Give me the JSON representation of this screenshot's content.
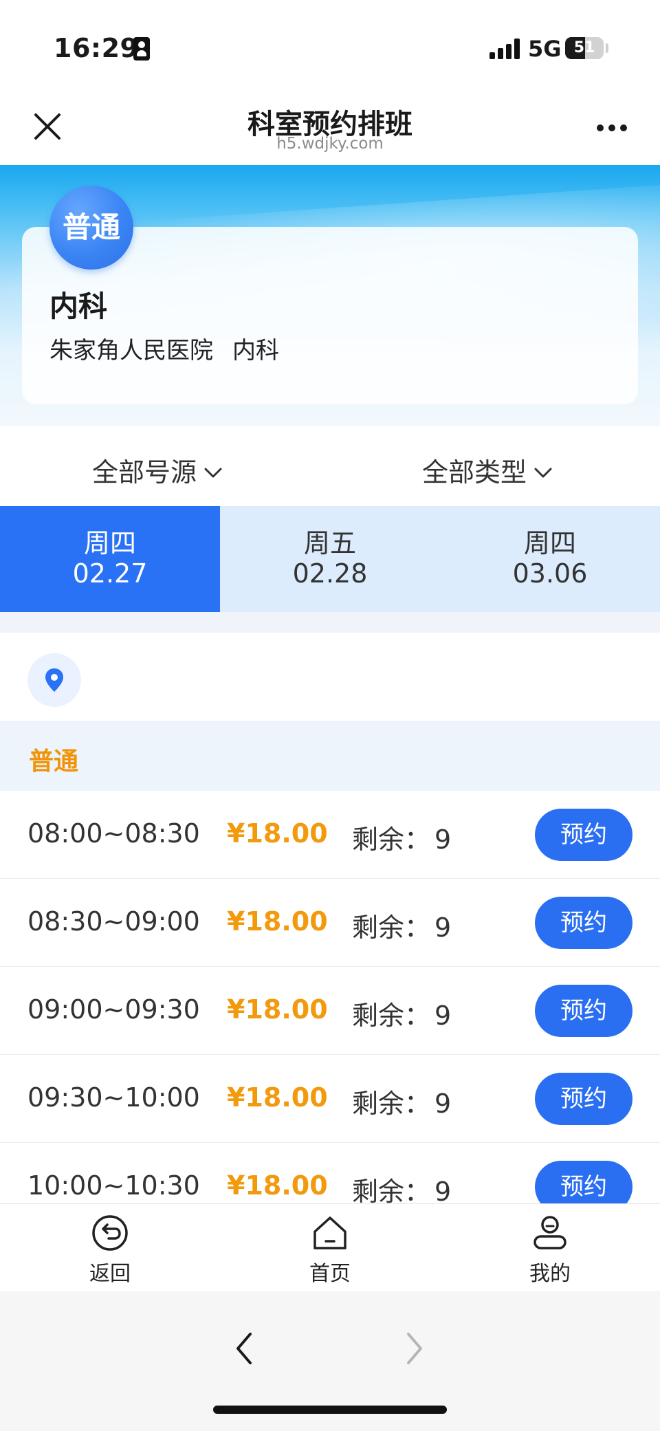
{
  "status_bar": {
    "time": "16:29",
    "network": "5G",
    "battery": "51",
    "battery_level": 0.51
  },
  "header": {
    "title": "科室预约排班",
    "domain": "h5.wdjky.com"
  },
  "department": {
    "type_badge": "普通",
    "name": "内科",
    "hospital": "朱家角人民医院",
    "dept": "内科"
  },
  "filters": {
    "source": "全部号源",
    "type": "全部类型"
  },
  "date_tabs": [
    {
      "weekday": "周四",
      "date": "02.27",
      "active": true
    },
    {
      "weekday": "周五",
      "date": "02.28",
      "active": false
    },
    {
      "weekday": "周四",
      "date": "03.06",
      "active": false
    }
  ],
  "section": {
    "title": "普通"
  },
  "slots": [
    {
      "time": "08:00~08:30",
      "price": "¥18.00",
      "remain_label": "剩余：",
      "remain": "9",
      "button": "预约"
    },
    {
      "time": "08:30~09:00",
      "price": "¥18.00",
      "remain_label": "剩余：",
      "remain": "9",
      "button": "预约"
    },
    {
      "time": "09:00~09:30",
      "price": "¥18.00",
      "remain_label": "剩余：",
      "remain": "9",
      "button": "预约"
    },
    {
      "time": "09:30~10:00",
      "price": "¥18.00",
      "remain_label": "剩余：",
      "remain": "9",
      "button": "预约"
    },
    {
      "time": "10:00~10:30",
      "price": "¥18.00",
      "remain_label": "剩余：",
      "remain": "9",
      "button": "预约"
    }
  ],
  "bottom_bar": {
    "back": "返回",
    "home": "首页",
    "mine": "我的"
  },
  "icons": {
    "close": "close-icon",
    "more": "more-icon",
    "location": "location-pin-icon",
    "back": "undo-circle-icon",
    "home": "home-icon",
    "mine": "user-icon",
    "chevron": "chevron-down-icon",
    "browser_back": "chevron-left-icon",
    "browser_forward": "chevron-right-icon"
  },
  "colors": {
    "accent": "#2a72f5",
    "price": "#f29a0e",
    "section_title": "#f0940a",
    "tab_bg": "#dcecfd"
  }
}
